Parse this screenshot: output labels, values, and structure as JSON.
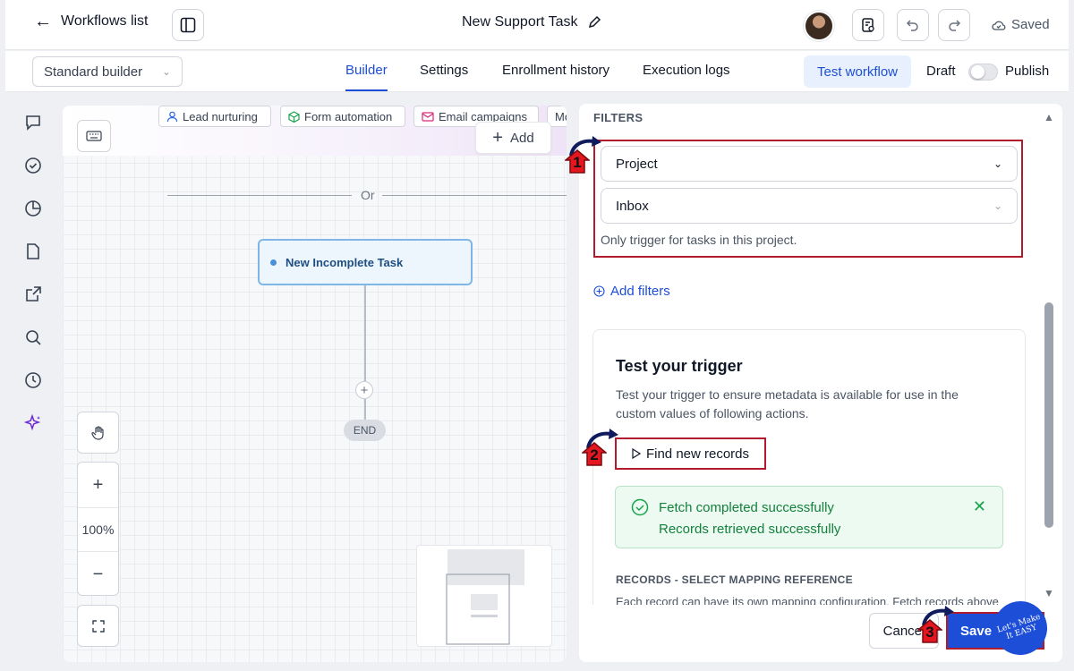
{
  "header": {
    "back_label": "Workflows list",
    "title": "New Support Task",
    "status": "Saved"
  },
  "nav": {
    "builder_select": "Standard builder",
    "tabs": [
      {
        "label": "Builder",
        "active": true
      },
      {
        "label": "Settings",
        "active": false
      },
      {
        "label": "Enrollment history",
        "active": false
      },
      {
        "label": "Execution logs",
        "active": false
      }
    ],
    "test_button": "Test workflow",
    "draft_label": "Draft",
    "publish_label": "Publish"
  },
  "canvas": {
    "chips": [
      "Lead nurturing",
      "Form automation",
      "Email campaigns",
      "Mo"
    ],
    "add_label": "Add",
    "or_label": "Or",
    "trigger_node": "New Incomplete Task",
    "end_label": "END",
    "zoom_level": "100%"
  },
  "panel": {
    "filters_label": "FILTERS",
    "project_select": "Project",
    "inbox_select": "Inbox",
    "filter_help": "Only trigger for tasks in this project.",
    "add_filters": "Add filters",
    "test_title": "Test your trigger",
    "test_desc": "Test your trigger to ensure metadata is available for use in the custom values of following actions.",
    "find_button": "Find new records",
    "success_title": "Fetch completed successfully",
    "success_sub": "Records retrieved successfully",
    "records_label": "RECORDS - SELECT MAPPING REFERENCE",
    "records_desc": "Each record can have its own mapping configuration. Fetch records above",
    "cancel": "Cancel",
    "save": "Save"
  },
  "annotations": {
    "badge_1": "1",
    "badge_2": "2",
    "badge_3": "3",
    "logo_text": "Let's Make It EASY"
  },
  "colors": {
    "accent": "#1d4ed8",
    "annotation_red": "#b01c2e",
    "success_green": "#15803d"
  }
}
